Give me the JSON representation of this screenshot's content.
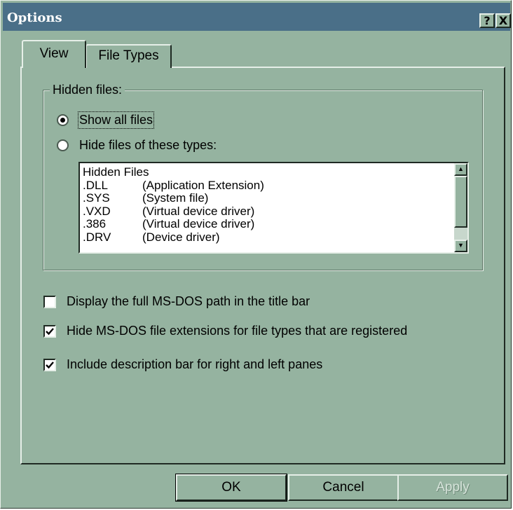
{
  "window": {
    "title": "Options",
    "help_button": "?",
    "close_button": "X"
  },
  "tabs": [
    {
      "label": "View",
      "active": true
    },
    {
      "label": "File Types",
      "active": false
    }
  ],
  "hidden_files": {
    "group_label": "Hidden files:",
    "options": [
      {
        "label": "Show all files",
        "selected": true
      },
      {
        "label": "Hide files of these types:",
        "selected": false
      }
    ],
    "list": {
      "header": "Hidden Files",
      "rows": [
        {
          "ext": ".DLL",
          "desc": "(Application Extension)"
        },
        {
          "ext": ".SYS",
          "desc": "(System file)"
        },
        {
          "ext": ".VXD",
          "desc": "(Virtual device driver)"
        },
        {
          "ext": ".386",
          "desc": "(Virtual device driver)"
        },
        {
          "ext": ".DRV",
          "desc": "(Device driver)"
        }
      ]
    }
  },
  "checkboxes": [
    {
      "label": "Display the full MS-DOS path in the title bar",
      "checked": false
    },
    {
      "label": "Hide MS-DOS file extensions for file types that are registered",
      "checked": true
    },
    {
      "label": "Include description bar for right and left panes",
      "checked": true
    }
  ],
  "buttons": {
    "ok": "OK",
    "cancel": "Cancel",
    "apply": "Apply"
  },
  "colors": {
    "dialog_bg": "#95b3a0",
    "titlebar_bg": "#4a6f88"
  }
}
